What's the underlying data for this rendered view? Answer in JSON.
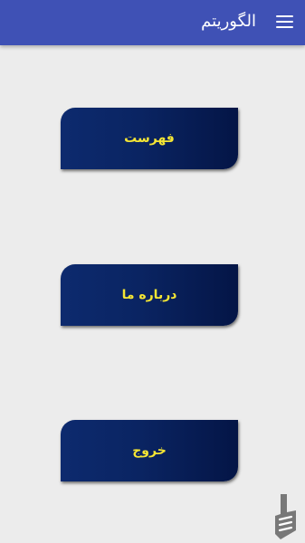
{
  "app_bar": {
    "title": "الگوریتم",
    "menu_icon": "hamburger-menu-icon"
  },
  "buttons": [
    {
      "label": "فهرست"
    },
    {
      "label": "درباره ما"
    },
    {
      "label": "خروج"
    }
  ],
  "colors": {
    "app_bar": "#3f51b5",
    "background": "#ececec",
    "button_fill_start": "#0d2a6e",
    "button_fill_end": "#041546",
    "button_text": "#f5e634"
  },
  "watermark_icon": "bazaar-logo-icon"
}
